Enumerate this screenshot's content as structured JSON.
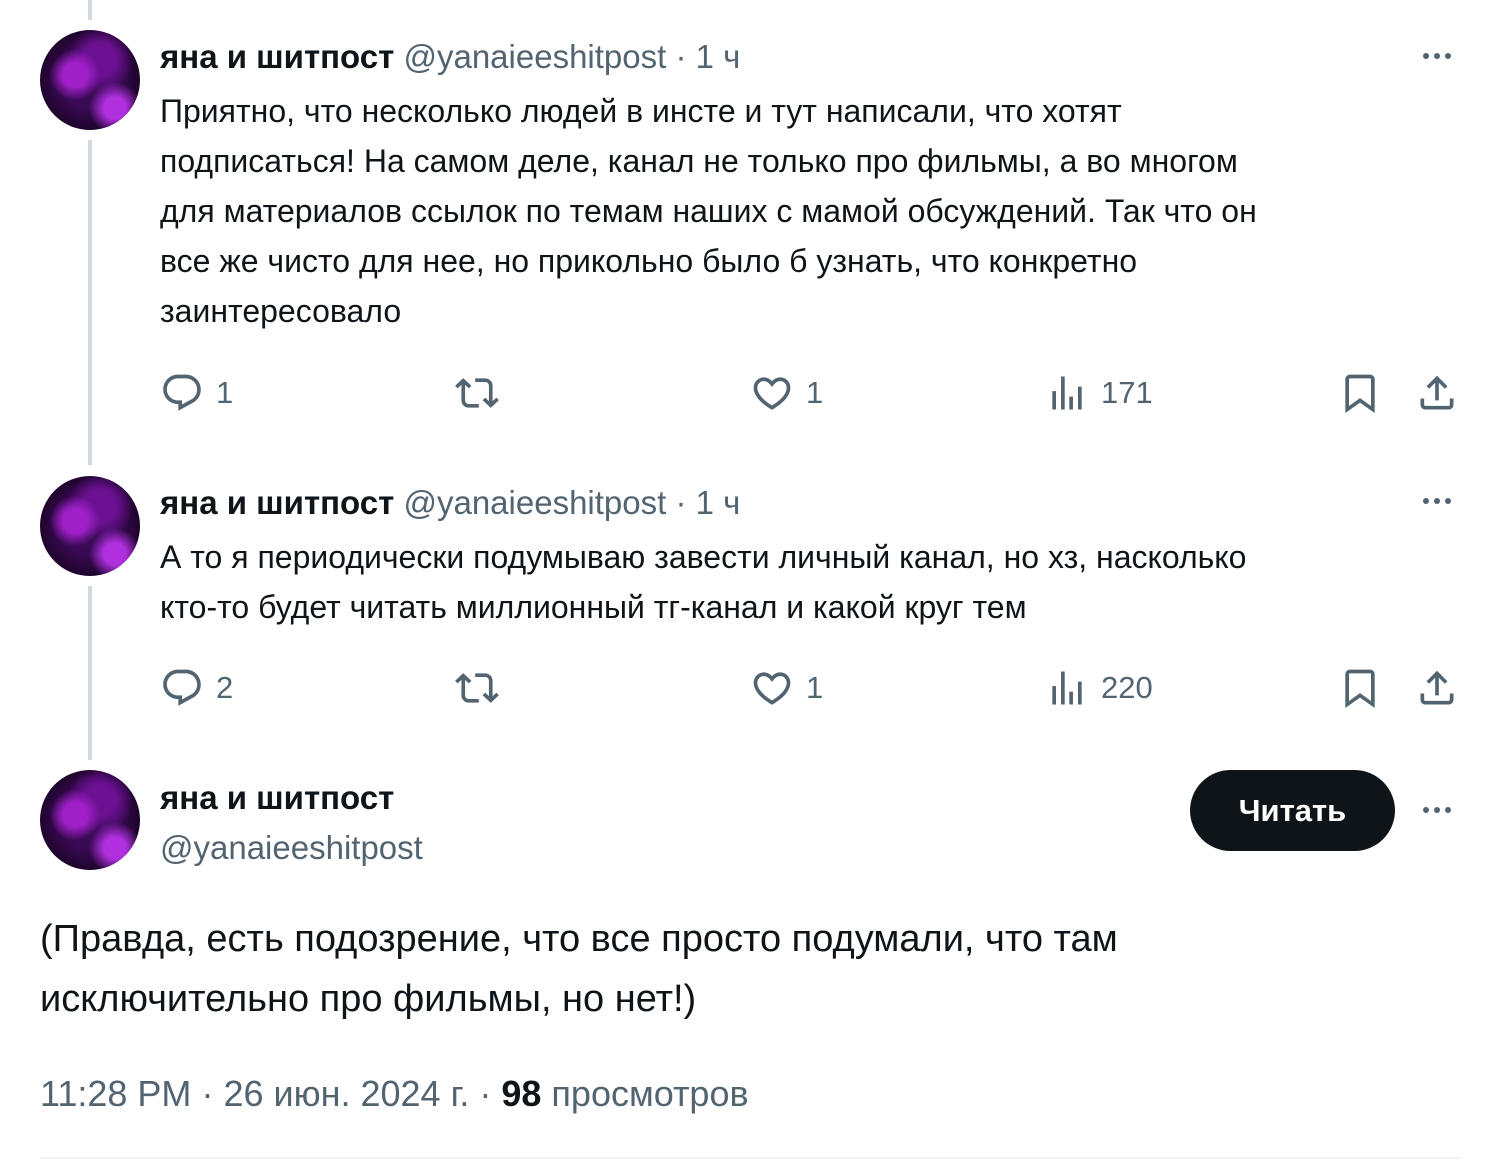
{
  "tweets": [
    {
      "name": "яна и шитпост",
      "handle": "@yanaieeshitpost",
      "time_sep": "·",
      "time": "1 ч",
      "text_lines": [
        "Приятно, что несколько людей в инсте и тут написали, что хотят",
        "подписаться! На самом деле, канал не только про фильмы, а во многом",
        "для материалов ссылок по темам наших с мамой обсуждений. Так что он",
        "все же чисто для нее, но прикольно было б узнать, что конкретно",
        "заинтересовало"
      ],
      "replies": "1",
      "retweets": "",
      "likes": "1",
      "views": "171"
    },
    {
      "name": "яна и шитпост",
      "handle": "@yanaieeshitpost",
      "time_sep": "·",
      "time": "1 ч",
      "text_lines": [
        "А то я периодически подумываю завести личный канал, но хз, насколько",
        "кто-то будет читать миллионный тг-канал и какой круг тем"
      ],
      "replies": "2",
      "retweets": "",
      "likes": "1",
      "views": "220"
    }
  ],
  "main": {
    "name": "яна и шитпост",
    "handle": "@yanaieeshitpost",
    "follow_label": "Читать",
    "text_lines": [
      "(Правда, есть подозрение, что все просто подумали, что там",
      "исключительно про фильмы, но нет!)"
    ],
    "time": "11:28 PM",
    "date": "26 июн. 2024 г.",
    "sep": "·",
    "views_count": "98",
    "views_label": "просмотров"
  },
  "icons": {
    "reply": "reply-icon",
    "retweet": "retweet-icon",
    "like": "heart-icon",
    "views": "views-icon",
    "bookmark": "bookmark-icon",
    "share": "share-icon",
    "more": "more-icon"
  },
  "colors": {
    "text": "#0f1419",
    "secondary": "#536471",
    "thread_line": "#cfd9de",
    "button_bg": "#0f1419"
  }
}
